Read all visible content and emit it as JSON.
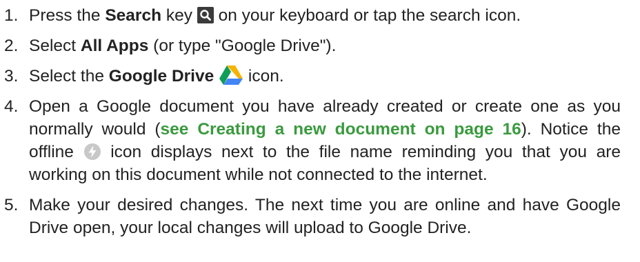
{
  "steps": [
    {
      "num": "1.",
      "t1": "Press the ",
      "kw": "Search",
      "t2": " key ",
      "t3": " on your keyboard or tap the search icon."
    },
    {
      "num": "2.",
      "t1": "Select ",
      "kw": "All Apps",
      "t2": " (or type \"Google Drive\")."
    },
    {
      "num": "3.",
      "t1": "Select the ",
      "kw": "Google Drive",
      "t2": " icon."
    },
    {
      "num": "4.",
      "t1": "Open a Google document you have already created or create one as you normally would (",
      "link": "see Creating a new document on page 16",
      "t2": "). Notice the offline ",
      "t3": " icon displays next to the file name reminding you that you are working on this document while not connected to the internet."
    },
    {
      "num": "5.",
      "t1": "Make your desired changes. The next time you are online and have Google Drive open, your local changes will upload to Google Drive."
    }
  ],
  "icons": {
    "search_key": "search-key-icon",
    "google_drive": "google-drive-icon",
    "offline": "offline-icon"
  },
  "colors": {
    "link": "#3a9a3e",
    "text": "#222222",
    "search_key_bg": "#3b3b3b",
    "offline_icon": "#c8c8c8"
  }
}
